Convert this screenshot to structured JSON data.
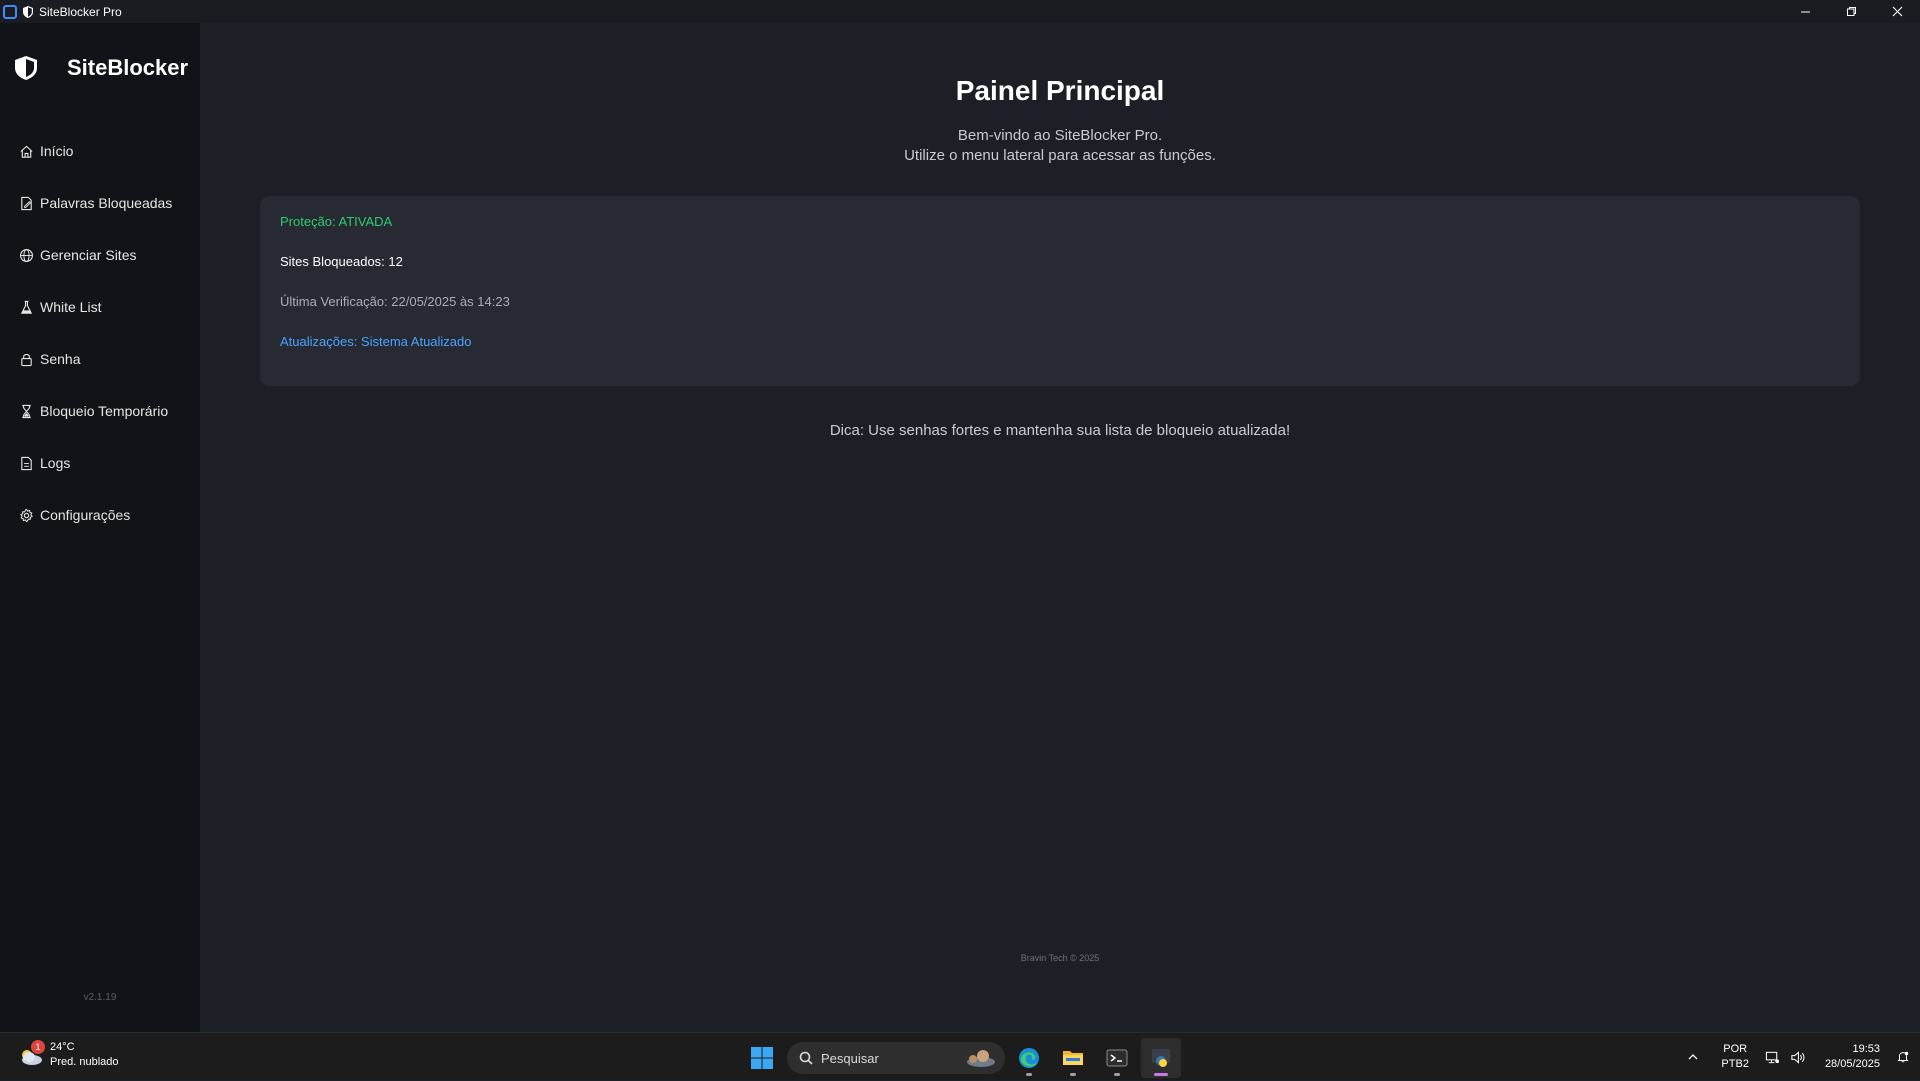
{
  "window": {
    "title": "SiteBlocker Pro"
  },
  "sidebar": {
    "brand": "SiteBlocker",
    "items": [
      {
        "label": "Início",
        "icon": "home-icon"
      },
      {
        "label": "Palavras Bloqueadas",
        "icon": "document-edit-icon"
      },
      {
        "label": "Gerenciar Sites",
        "icon": "globe-icon"
      },
      {
        "label": "White List",
        "icon": "flask-icon"
      },
      {
        "label": "Senha",
        "icon": "lock-icon"
      },
      {
        "label": "Bloqueio Temporário",
        "icon": "hourglass-icon"
      },
      {
        "label": "Logs",
        "icon": "file-icon"
      },
      {
        "label": "Configurações",
        "icon": "gear-icon"
      }
    ],
    "version": "v2.1.19"
  },
  "main": {
    "title": "Painel Principal",
    "subtitle_1": "Bem-vindo ao SiteBlocker Pro.",
    "subtitle_2": "Utilize o menu lateral para acessar as funções.",
    "status": {
      "protection": "Proteção: ATIVADA",
      "blocked_sites": "Sites Bloqueados: 12",
      "last_check": "Última Verificação: 22/05/2025 às 14:23",
      "updates": "Atualizações: Sistema Atualizado"
    },
    "tip": "Dica: Use senhas fortes e mantenha sua lista de bloqueio atualizada!",
    "footer": "Bravin Tech © 2025"
  },
  "taskbar": {
    "weather": {
      "temp": "24°C",
      "desc": "Pred. nublado",
      "badge": "1"
    },
    "search_placeholder": "Pesquisar",
    "lang_1": "POR",
    "lang_2": "PTB2",
    "time": "19:53",
    "date": "28/05/2025"
  },
  "colors": {
    "protection_on": "#2ecc71",
    "updates_link": "#4aa3ff",
    "sidebar_bg": "#121318",
    "main_bg": "#1d1f26",
    "card_bg": "#272a33"
  }
}
